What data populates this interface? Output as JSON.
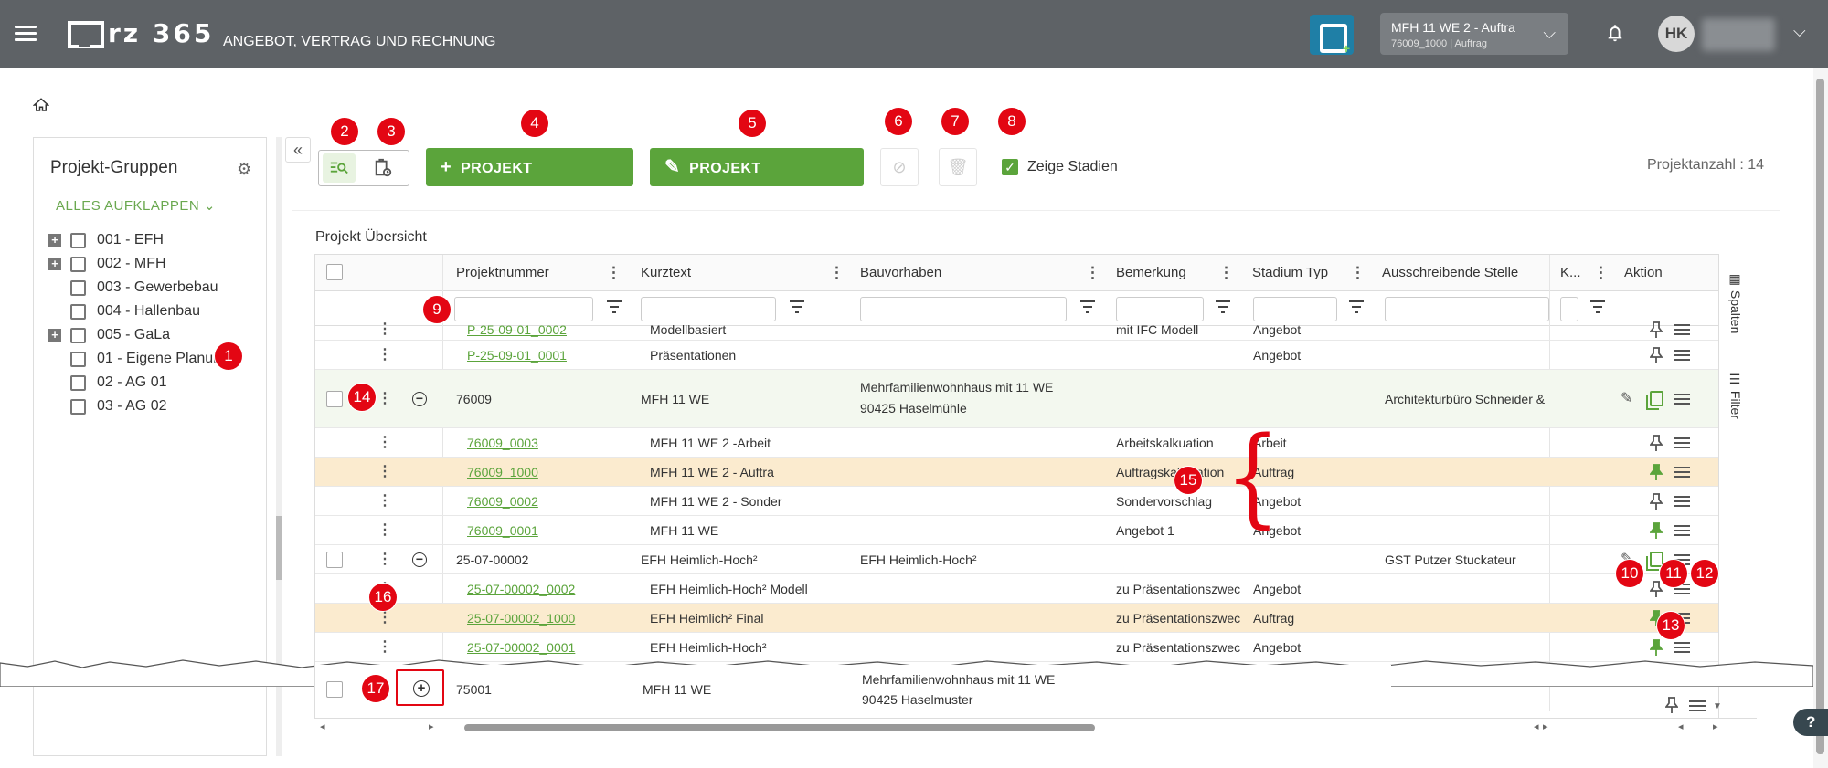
{
  "topbar": {
    "logo_text": "rz 365",
    "subtitle": "ANGEBOT, VERTRAG UND RECHNUNG",
    "project_select": {
      "title": "MFH 11 WE 2 - Auftra",
      "subtitle": "76009_1000 | Auftrag"
    },
    "user_initials": "HK"
  },
  "sidebar": {
    "title": "Projekt-Gruppen",
    "expand_all": "ALLES AUFKLAPPEN",
    "items": [
      {
        "label": "001 - EFH",
        "has_plus": true
      },
      {
        "label": "002 - MFH",
        "has_plus": true
      },
      {
        "label": "003 - Gewerbebau",
        "has_plus": false
      },
      {
        "label": "004 - Hallenbau",
        "has_plus": false
      },
      {
        "label": "005 - GaLa",
        "has_plus": true
      },
      {
        "label": "01 - Eigene Planung",
        "has_plus": false
      },
      {
        "label": "02 - AG 01",
        "has_plus": false
      },
      {
        "label": "03 - AG 02",
        "has_plus": false
      }
    ]
  },
  "toolbar": {
    "create_label": "PROJEKT ERSTELLEN",
    "manage_label": "PROJEKT VERWALTEN",
    "show_stadien_label": "Zeige Stadien",
    "project_count": "Projektanzahl : 14"
  },
  "grid": {
    "title": "Projekt Übersicht",
    "columns": [
      "Projektnummer",
      "Kurztext",
      "Bauvorhaben",
      "Bemerkung",
      "Stadium Typ",
      "Ausschreibende Stelle",
      "K...",
      "Aktion"
    ],
    "rows": [
      {
        "nr": "P-25-09-01_0002",
        "kurztext": "Modellbasiert",
        "bauvorhaben": "",
        "bemerkung": "mit IFC Modell",
        "stadium": "Angebot",
        "stelle": ""
      },
      {
        "nr": "P-25-09-01_0001",
        "kurztext": "Präsentationen",
        "bauvorhaben": "",
        "bemerkung": "",
        "stadium": "Angebot",
        "stelle": ""
      },
      {
        "nr": "76009",
        "kurztext": "MFH 11 WE",
        "bauvorhaben": "Mehrfamilienwohnhaus mit 11 WE",
        "bauvorhaben2": "90425 Haselmühle",
        "bemerkung": "",
        "stadium": "",
        "stelle": "Architekturbüro Schneider &"
      },
      {
        "nr": "76009_0003",
        "kurztext": "MFH 11 WE 2 -Arbeit",
        "bauvorhaben": "",
        "bemerkung": "Arbeitskalkuation",
        "stadium": "Arbeit",
        "stelle": ""
      },
      {
        "nr": "76009_1000",
        "kurztext": "MFH 11 WE 2 - Auftra",
        "bauvorhaben": "",
        "bemerkung": "Auftragskalkulation",
        "stadium": "Auftrag",
        "stelle": ""
      },
      {
        "nr": "76009_0002",
        "kurztext": "MFH 11 WE 2 - Sonder",
        "bauvorhaben": "",
        "bemerkung": "Sondervorschlag",
        "stadium": "Angebot",
        "stelle": ""
      },
      {
        "nr": "76009_0001",
        "kurztext": "MFH 11 WE",
        "bauvorhaben": "",
        "bemerkung": "Angebot 1",
        "stadium": "Angebot",
        "stelle": ""
      },
      {
        "nr": "25-07-00002",
        "kurztext": "EFH Heimlich-Hoch²",
        "bauvorhaben": "EFH Heimlich-Hoch²",
        "bemerkung": "",
        "stadium": "",
        "stelle": "GST Putzer Stuckateur"
      },
      {
        "nr": "25-07-00002_0002",
        "kurztext": "EFH Heimlich-Hoch² Modell",
        "bauvorhaben": "",
        "bemerkung": "zu Präsentationszwec",
        "stadium": "Angebot",
        "stelle": ""
      },
      {
        "nr": "25-07-00002_1000",
        "kurztext": "EFH Heimlich² Final",
        "bauvorhaben": "",
        "bemerkung": "zu Präsentationszwec",
        "stadium": "Auftrag",
        "stelle": ""
      },
      {
        "nr": "25-07-00002_0001",
        "kurztext": "EFH Heimlich-Hoch²",
        "bauvorhaben": "",
        "bemerkung": "zu Präsentationszwec",
        "stadium": "Angebot",
        "stelle": ""
      },
      {
        "nr": "75001",
        "kurztext": "MFH 11 WE",
        "bauvorhaben": "Mehrfamilienwohnhaus mit 11 WE",
        "bauvorhaben2": "90425 Haselmuster",
        "bemerkung": "",
        "stadium": "",
        "stelle": ""
      }
    ],
    "side_tabs": [
      "Spalten",
      "Filter"
    ]
  },
  "badges": [
    "1",
    "2",
    "3",
    "4",
    "5",
    "6",
    "7",
    "8",
    "9",
    "10",
    "11",
    "12",
    "13",
    "14",
    "15",
    "16",
    "17"
  ],
  "help_label": "?",
  "colors": {
    "accent": "#5ba43b",
    "topbar": "#5e6266",
    "badge": "#e30613",
    "highlight": "#fbebcf"
  }
}
